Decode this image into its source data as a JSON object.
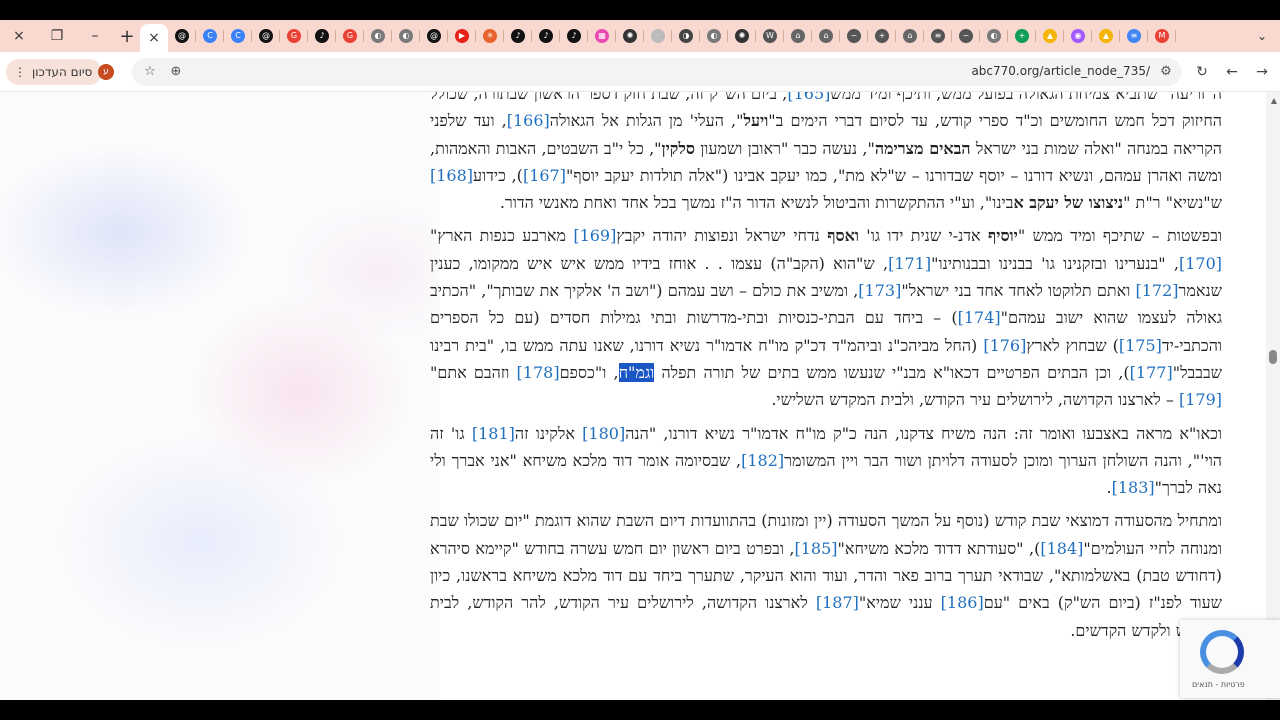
{
  "browser": {
    "tabs": {
      "close_label": "×",
      "new_tab_label": "+",
      "active_close": "×",
      "icons": [
        {
          "name": "threads-icon",
          "color": "#111111",
          "glyph": "@"
        },
        {
          "name": "chrome-icon",
          "color": "#3b82f6",
          "glyph": "C"
        },
        {
          "name": "chrome-icon",
          "color": "#3b82f6",
          "glyph": "C"
        },
        {
          "name": "threads-icon",
          "color": "#111111",
          "glyph": "@"
        },
        {
          "name": "google-icon",
          "color": "#ea4335",
          "glyph": "G"
        },
        {
          "name": "tiktok-icon",
          "color": "#111111",
          "glyph": "♪"
        },
        {
          "name": "google-icon",
          "color": "#ea4335",
          "glyph": "G"
        },
        {
          "name": "globe-icon",
          "color": "#7a7a7a",
          "glyph": "◐"
        },
        {
          "name": "globe-icon",
          "color": "#7a7a7a",
          "glyph": "◐"
        },
        {
          "name": "threads-icon",
          "color": "#111111",
          "glyph": "@"
        },
        {
          "name": "youtube-icon",
          "color": "#e62117",
          "glyph": "▶"
        },
        {
          "name": "asterisk-icon",
          "color": "#e8632b",
          "glyph": "✳"
        },
        {
          "name": "tiktok-icon",
          "color": "#111111",
          "glyph": "♪"
        },
        {
          "name": "tiktok-icon",
          "color": "#111111",
          "glyph": "♪"
        },
        {
          "name": "tiktok-icon",
          "color": "#111111",
          "glyph": "♪"
        },
        {
          "name": "gallery-icon",
          "color": "#e94cb0",
          "glyph": "▦"
        },
        {
          "name": "openai-icon",
          "color": "#333333",
          "glyph": "✺"
        },
        {
          "name": "blank-icon",
          "color": "#bbbbbb",
          "glyph": "·"
        },
        {
          "name": "half-moon-icon",
          "color": "#444444",
          "glyph": "◑"
        },
        {
          "name": "globe-icon",
          "color": "#7a7a7a",
          "glyph": "◐"
        },
        {
          "name": "openai-icon",
          "color": "#333333",
          "glyph": "✺"
        },
        {
          "name": "wiki-icon",
          "color": "#555555",
          "glyph": "W"
        },
        {
          "name": "temple-icon",
          "color": "#666666",
          "glyph": "⌂"
        },
        {
          "name": "temple-icon",
          "color": "#666666",
          "glyph": "⌂"
        },
        {
          "name": "squiggle-icon",
          "color": "#555555",
          "glyph": "~"
        },
        {
          "name": "plus-box-icon",
          "color": "#555555",
          "glyph": "+"
        },
        {
          "name": "temple-icon",
          "color": "#666666",
          "glyph": "⌂"
        },
        {
          "name": "site-icon",
          "color": "#555555",
          "glyph": "≡"
        },
        {
          "name": "squiggle-icon",
          "color": "#555555",
          "glyph": "~"
        },
        {
          "name": "globe-icon",
          "color": "#7a7a7a",
          "glyph": "◐"
        },
        {
          "name": "sheets-plus-icon",
          "color": "#0f9d58",
          "glyph": "+"
        },
        {
          "name": "drive-icon",
          "color": "#f4b400",
          "glyph": "▲"
        },
        {
          "name": "figma-icon",
          "color": "#a259ff",
          "glyph": "◉"
        },
        {
          "name": "drive-icon",
          "color": "#f4b400",
          "glyph": "▲"
        },
        {
          "name": "docs-icon",
          "color": "#4285f4",
          "glyph": "≡"
        },
        {
          "name": "gmail-icon",
          "color": "#ea4335",
          "glyph": "M"
        }
      ],
      "far_right": "⌄"
    },
    "toolbar": {
      "profile_label": "סיום העדכון",
      "profile_menu": "⋮",
      "avatar_letter": "ע",
      "url": "abc770.org/article_node_735/",
      "star": "☆",
      "zoom": "⊕",
      "site_settings": "⚙",
      "reload": "↻",
      "back": "←",
      "forward": "→"
    }
  },
  "article": {
    "p1": {
      "t1": "ה\"זריעה\" שתביא צמיחת הגאולה בפועל ממש, ותיכף ומיד ממש",
      "r165": "[165]",
      "t2": ", ביום הש\"ק זה, שבת חזק דספר הראשון שבתורה, שכולל החיזוק דכל חמש החומשים וכ\"ד ספרי קודש, עד לסיום דברי הימים ב\"",
      "b1": "ויעל",
      "t3": "\", העלי' מן הגלות אל הגאולה",
      "r166": "[166]",
      "t4": ", ועד שלפני הקריאה במנחה \"ואלה שמות בני ישראל ",
      "b2": "הבאים מצרימה",
      "t5": "\", נעשה כבר \"ראובן ושמעון ",
      "b3": "סלקין",
      "t6": "\", כל י\"ב השבטים, האבות והאמהות, ומשה ואהרן עמהם, ונשיא דורנו – יוסף שבדורנו – ש\"לא מת\", כמו יעקב אבינו (\"אלה תולדות יעקב יוסף\"",
      "r167": "[167]",
      "t7": "), כידוע",
      "r168": "[168]",
      "t8": " ש\"נשיא\" ר\"ת \"",
      "b4": "ניצוצו של יעקב א",
      "t9": "בינו\", וע\"י ההתקשרות והביטול לנשיא הדור ה\"ז נמשך בכל אחד ואחת מאנשי הדור."
    },
    "p2": {
      "t1": "ובפשטות – שתיכף ומיד ממש \"",
      "b1": "יוסיף",
      "t2": " אדנ-י שנית ידו גו' ",
      "b2": "ואסף",
      "t3": " נדחי ישראל ונפוצות יהודה יקבץ",
      "r169": "[169]",
      "t4": " מארבע כנפות הארץ\"",
      "r170": "[170]",
      "t5": ", \"בנערינו ובזקנינו גו' בבנינו ובבנותינו\"",
      "r171": "[171]",
      "t6": ", ש\"הוא (הקב\"ה) עצמו . . אוחז בידיו ממש איש איש ממקומו, כענין שנאמר",
      "r172": "[172]",
      "t7": " ואתם תלוקטו לאחד אחד בני ישראל\"",
      "r173": "[173]",
      "t8": ", ומשיב את כולם – ושב עמהם (\"ושב ה' אלקיך את שבותך\", \"הכתיב גאולה לעצמו שהוא ישוב עמהם\"",
      "r174": "[174]",
      "t9": ") – ביחד עם הבתי-כנסיות ובתי-מדרשות ובתי גמילות חסדים (עם כל הספרים והכתבי-יד",
      "r175": "[175]",
      "t10": ") שבחוץ לארץ",
      "r176": "[176]",
      "t11": " (החל מביהכ\"נ וביהמ\"ד דכ\"ק מו\"ח אדמו\"ר נשיא דורנו, שאנו עתה ממש בו, \"בית רבינו שבבבל\"",
      "r177": "[177]",
      "t12": "), וכן הבתים הפרטיים דכאו\"א מבנ\"י שנעשו ממש בתים של תורה תפלה ",
      "hl": "וגמ\"ח",
      "t13": ", ו\"כספם",
      "r178": "[178]",
      "t14": " וזהבם אתם\"",
      "r179": "[179]",
      "t15": " – לארצנו הקדושה, לירושלים עיר הקודש, ולבית המקדש השלישי."
    },
    "p3": {
      "t1": "וכאו\"א מראה באצבעו ואומר זה: הנה משיח צדקנו, הנה כ\"ק מו\"ח אדמו\"ר נשיא דורנו, \"הנה",
      "r180": "[180]",
      "t2": " אלקינו זה",
      "r181": "[181]",
      "t3": " גו' זה הוי'\", והנה השולחן הערוך ומוכן לסעודה דלויתן ושור הבר ויין המשומר",
      "r182": "[182]",
      "t4": ", שבסיומה אומר דוד מלכא משיחא \"אני אברך ולי נאה לברך\"",
      "r183": "[183]",
      "t5": "."
    },
    "p4": {
      "t1": "ומתחיל מהסעודה דמוצאי שבת קודש (נוסף על המשך הסעודה (יין ומזונות) בהתוועדות דיום השבת שהוא דוגמת \"יום שכולו שבת ומנוחה לחיי העולמים\"",
      "r184": "[184]",
      "t2": "), \"סעודתא דדוד מלכא משיחא\"",
      "r185": "[185]",
      "t3": ", ובפרט ביום ראשון יום חמש עשרה בחודש \"קיימא סיהרא (דחודש טבת) באשלמותא\", שבודאי תערך ברוב פאר והדר, ועוד והוא העיקר, שתערך ביחד עם דוד מלכא משיחא בראשנו, כיון שעוד לפנ\"ז (ביום הש\"ק) באים \"עם",
      "r186": "[186]",
      "t4": " ענני שמיא\"",
      "r187": "[187]",
      "t5": " לארצנו הקדושה, לירושלים עיר הקודש, להר הקודש, לבית המקדש ולקדש הקדשים."
    },
    "recaptcha_text": "פרטיות - תנאים"
  }
}
